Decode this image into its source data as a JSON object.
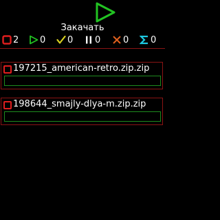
{
  "header": {
    "play_icon": "play-triangle-icon",
    "download_label": "Закачать"
  },
  "stats": [
    {
      "name": "selected",
      "icon": "red-square-icon",
      "color": "#e01e1e",
      "value": "2"
    },
    {
      "name": "active",
      "icon": "green-play-icon",
      "color": "#22c322",
      "value": "0"
    },
    {
      "name": "done",
      "icon": "yellow-check-icon",
      "color": "#d8d020",
      "value": "0"
    },
    {
      "name": "paused",
      "icon": "white-pause-icon",
      "color": "#ffffff",
      "value": "0"
    },
    {
      "name": "error",
      "icon": "orange-x-icon",
      "color": "#e0601e",
      "value": "0"
    },
    {
      "name": "total",
      "icon": "cyan-sigma-icon",
      "color": "#1ec8e0",
      "value": "0"
    }
  ],
  "downloads": [
    {
      "filename": "197215_american-retro.zip.zip",
      "progress": 0
    },
    {
      "filename": "198644_smajly-dlya-m.zip.zip",
      "progress": 0
    }
  ],
  "colors": {
    "background": "#000000",
    "accent_red": "#e01e1e",
    "border_red": "#8b1414",
    "progress_green": "#1e8c1e",
    "play_green": "#22c322"
  }
}
